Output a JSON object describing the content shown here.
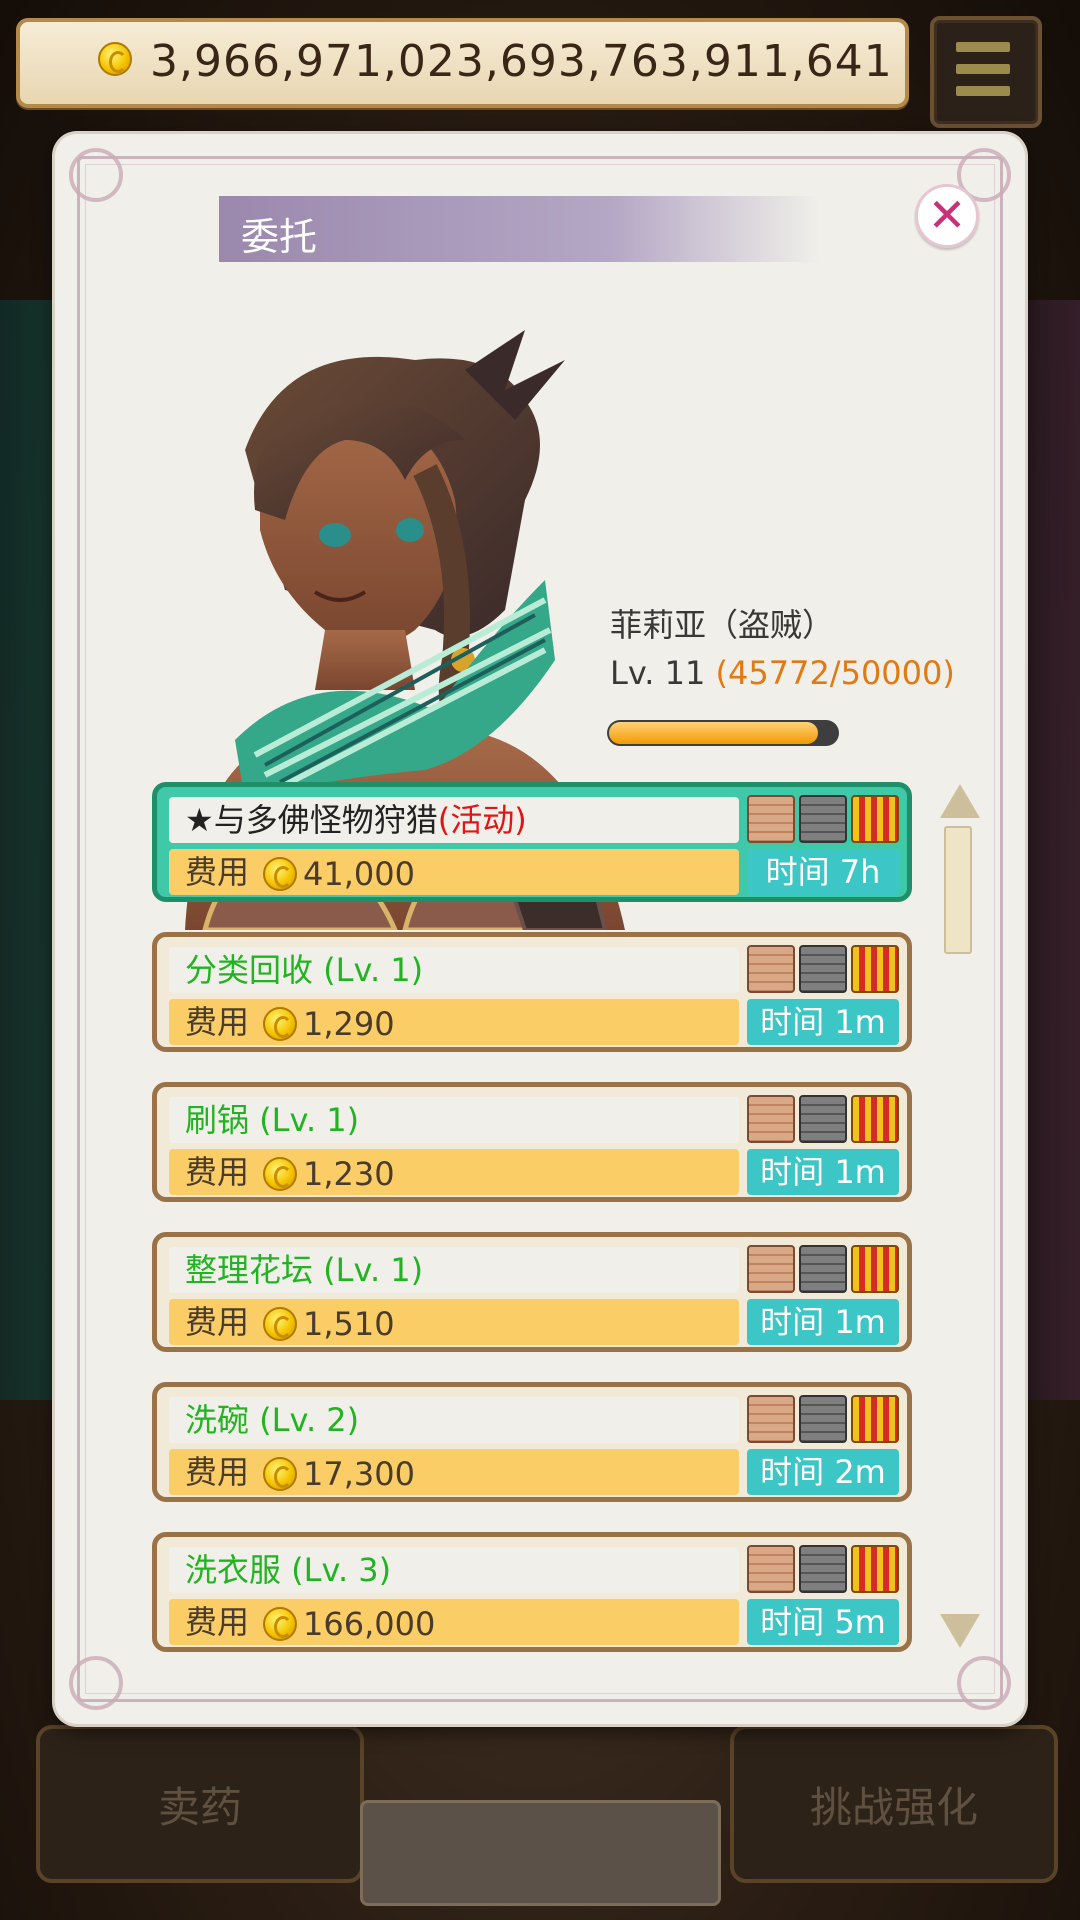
{
  "currency": {
    "amount": "3,966,971,023,693,763,911,641"
  },
  "dialog": {
    "title": "委托",
    "close_label": "✕"
  },
  "character": {
    "name": "菲莉亚（盗贼）",
    "level_text": "Lv. 11",
    "exp_text": "(45772/50000)",
    "exp_fraction": 0.915
  },
  "quests": [
    {
      "name": "★与多佛怪物狩猎",
      "tag": "(活动)",
      "cost_label": "费用",
      "cost": "41,000",
      "time": "时间 7h",
      "active": true
    },
    {
      "name": "分类回收 (Lv. 1)",
      "tag": "",
      "cost_label": "费用",
      "cost": "1,290",
      "time": "时间 1m",
      "active": false
    },
    {
      "name": "刷锅 (Lv. 1)",
      "tag": "",
      "cost_label": "费用",
      "cost": "1,230",
      "time": "时间 1m",
      "active": false
    },
    {
      "name": "整理花坛 (Lv. 1)",
      "tag": "",
      "cost_label": "费用",
      "cost": "1,510",
      "time": "时间 1m",
      "active": false
    },
    {
      "name": "洗碗 (Lv. 2)",
      "tag": "",
      "cost_label": "费用",
      "cost": "17,300",
      "time": "时间 2m",
      "active": false
    },
    {
      "name": "洗衣服 (Lv. 3)",
      "tag": "",
      "cost_label": "费用",
      "cost": "166,000",
      "time": "时间 5m",
      "active": false
    }
  ],
  "bottom": {
    "left_label": "卖药",
    "right_label": "挑战强化"
  },
  "colors": {
    "accent_green": "#22b322",
    "event_red": "#e01515",
    "exp_orange": "#e27a12",
    "time_teal": "#3dc6c6",
    "cost_yellow": "#fbcd66"
  }
}
